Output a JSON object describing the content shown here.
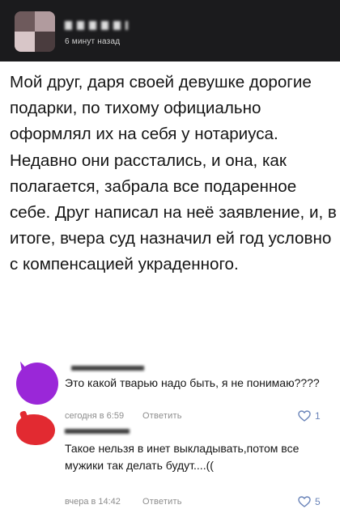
{
  "post": {
    "time": "6 минут назад",
    "text": "Мой друг, даря своей девушке дорогие подарки, по тихому официально оформлял их на себя у нотариуса. Недавно они расстались, и она, как полагается, забрала все подаренное себе. Друг написал на неё заявление, и, в итоге, вчера суд назначил ей год условно с компенсацией украденного."
  },
  "comments": [
    {
      "text": "Это какой тварью надо быть, я не понимаю????",
      "time": "сегодня в 6:59",
      "reply_label": "Ответить",
      "likes": "1",
      "avatar_color": "#9a27d8"
    },
    {
      "text": "Такое нельзя в инет выкладывать,потом все мужики так делать будут....((",
      "time": "вчера в 14:42",
      "reply_label": "Ответить",
      "likes": "5",
      "avatar_color": "#e22a31"
    }
  ],
  "icons": {
    "like": "heart-outline-icon"
  },
  "colors": {
    "header_bg": "#1b1b1d",
    "meta_text": "#8d8d8d",
    "like_accent": "#6a84b9"
  }
}
